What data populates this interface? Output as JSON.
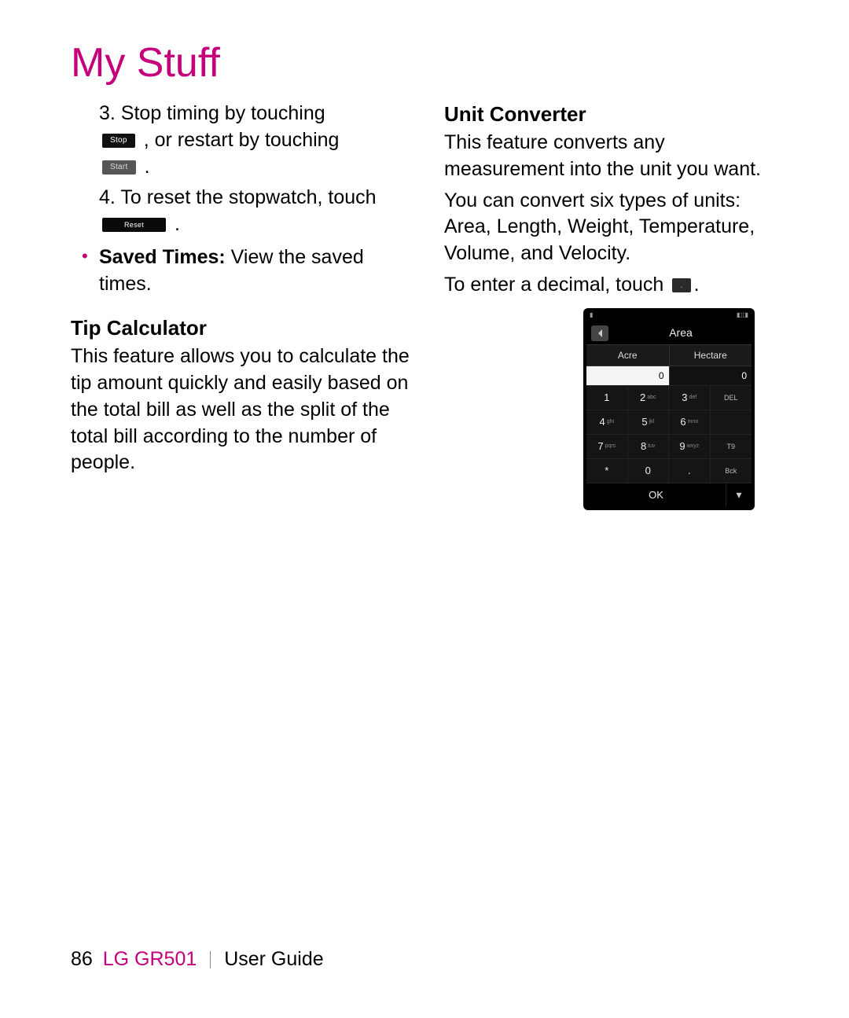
{
  "title": "My Stuff",
  "left": {
    "step3_a": "3. Stop timing by touching",
    "step3_b": ", or restart by touching",
    "step3_c": ".",
    "stop_btn": "Stop",
    "start_btn": "Start",
    "step4_a": "4. To reset the stopwatch, touch",
    "step4_b": ".",
    "reset_btn": "Reset",
    "bullet_bold": "Saved Times:",
    "bullet_rest": " View the saved times.",
    "tip_head": "Tip Calculator",
    "tip_body": "This feature allows you to calculate the tip amount quickly and easily based on the total bill as well as the split of the total bill according to the number of people."
  },
  "right": {
    "unit_head": "Unit Converter",
    "unit_p1": "This feature converts any measurement into the unit you want.",
    "unit_p2": "You can convert six types of units: Area, Length, Weight, Temperature, Volume, and Velocity.",
    "unit_p3a": "To enter a decimal, touch ",
    "unit_p3b": ".",
    "decimal_btn": "."
  },
  "phone": {
    "title": "Area",
    "unit1": "Acre",
    "unit2": "Hectare",
    "val1": "0",
    "val2": "0",
    "keys": [
      {
        "n": "1",
        "s": ""
      },
      {
        "n": "2",
        "s": "abc"
      },
      {
        "n": "3",
        "s": "def"
      },
      {
        "n": "DEL",
        "s": "",
        "fn": true
      },
      {
        "n": "4",
        "s": "ghi"
      },
      {
        "n": "5",
        "s": "jkl"
      },
      {
        "n": "6",
        "s": "mno"
      },
      {
        "n": "",
        "s": "",
        "fn": true
      },
      {
        "n": "7",
        "s": "pqrs"
      },
      {
        "n": "8",
        "s": "tuv"
      },
      {
        "n": "9",
        "s": "wxyz"
      },
      {
        "n": "T9",
        "s": "",
        "fn": true
      },
      {
        "n": "*",
        "s": ""
      },
      {
        "n": "0",
        "s": ""
      },
      {
        "n": ".",
        "s": ""
      },
      {
        "n": "Bck",
        "s": "",
        "fn": true
      }
    ],
    "ok": "OK"
  },
  "footer": {
    "page": "86",
    "model": "LG GR501",
    "guide": "User Guide"
  }
}
